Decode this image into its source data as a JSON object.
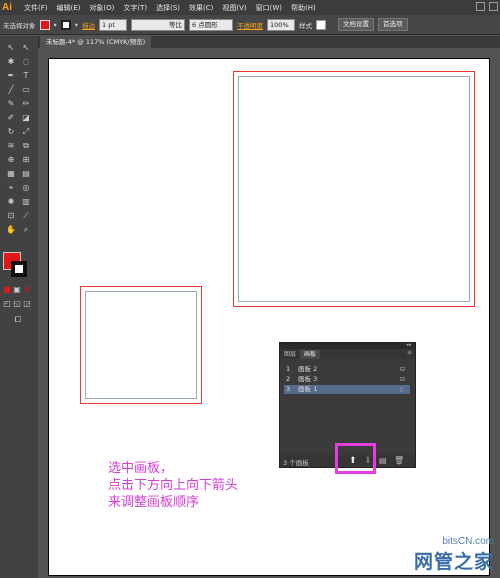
{
  "app": {
    "logo": "Ai"
  },
  "menu": [
    "文件(F)",
    "编辑(E)",
    "对象(O)",
    "文字(T)",
    "选择(S)",
    "效果(C)",
    "视图(V)",
    "窗口(W)",
    "帮助(H)"
  ],
  "control_bar": {
    "selection": "未选择对象",
    "stroke_label": "描边",
    "stroke_weight": "1 pt",
    "stroke_style": "等比",
    "brush": "6 点圆形",
    "opacity_label": "不透明度",
    "opacity": "100%",
    "style_label": "样式",
    "doc_setup": "文档设置",
    "preferences": "首选项"
  },
  "document_tab": "未标题-4* @ 117% (CMYK/预览)",
  "artboards_panel": {
    "tabs": [
      "图层",
      "画板"
    ],
    "rows": [
      {
        "num": "1",
        "name": "画板 2",
        "selected": false
      },
      {
        "num": "2",
        "name": "画板 3",
        "selected": false
      },
      {
        "num": "3",
        "name": "画板 1",
        "selected": true
      }
    ],
    "footer": "3 个画板"
  },
  "annotation": "选中画板，\n点击下方向上向下箭头\n来调整画板顺序",
  "watermark": {
    "line1": "bitsCN.com",
    "line2": "网管之家"
  },
  "colors": {
    "fill": "#e01818",
    "artboard_border": "#e33333",
    "highlight": "#e43de4"
  }
}
